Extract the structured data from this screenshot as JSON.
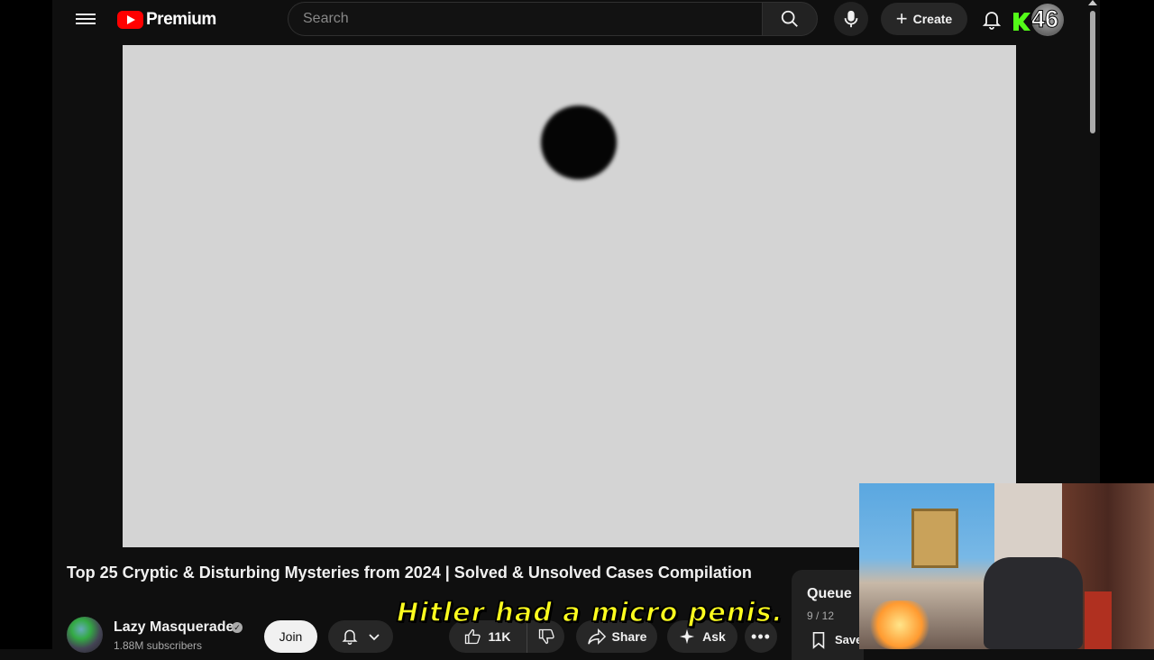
{
  "header": {
    "logo_text": "Premium",
    "search_placeholder": "Search",
    "create_label": "Create",
    "overlay_badge": "46"
  },
  "video": {
    "title": "Top 25 Cryptic & Disturbing Mysteries from 2024 | Solved & Unsolved Cases Compilation",
    "caption": "Hitler had a micro penis."
  },
  "channel": {
    "name": "Lazy Masquerade",
    "subscribers": "1.88M subscribers",
    "join_label": "Join"
  },
  "actions": {
    "likes": "11K",
    "share_label": "Share",
    "ask_label": "Ask"
  },
  "queue": {
    "title": "Queue",
    "count": "9 / 12",
    "save_label": "Save"
  },
  "colors": {
    "background": "#0f0f0f",
    "brand_red": "#ff0000",
    "caption_yellow": "#ffff1e",
    "player_bg": "#d4d4d4"
  }
}
